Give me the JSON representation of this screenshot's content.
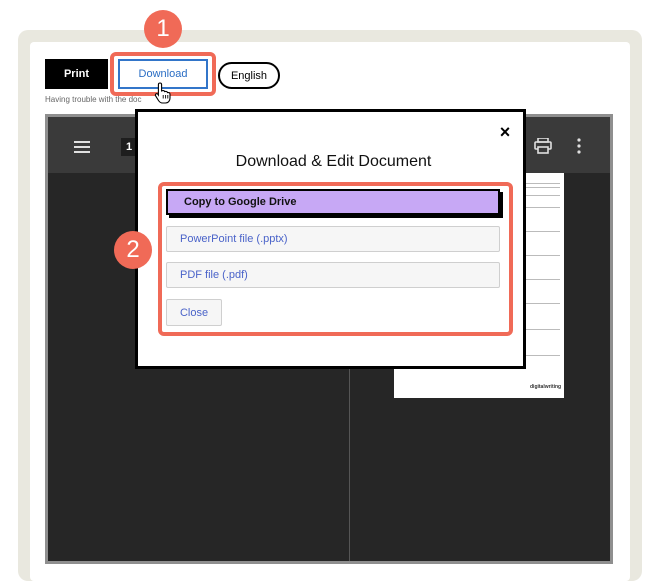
{
  "toolbar": {
    "print_label": "Print",
    "download_label": "Download",
    "language_label": "English",
    "trouble_text": "Having trouble with the doc"
  },
  "annotations": {
    "step1": "1",
    "step2": "2",
    "highlight_color": "#f06a57"
  },
  "viewer": {
    "page_number": "1",
    "icons": [
      "menu-icon",
      "print-icon",
      "more-vert-icon"
    ]
  },
  "modal": {
    "title": "Download & Edit Document",
    "close_icon": "×",
    "options": {
      "google_drive": "Copy to Google Drive",
      "pptx": "PowerPoint file (.pptx)",
      "pdf": "PDF file (.pdf)",
      "close": "Close"
    },
    "accent_color": "#c7a8f5"
  },
  "preview": {
    "brand": "digitalwriting"
  }
}
